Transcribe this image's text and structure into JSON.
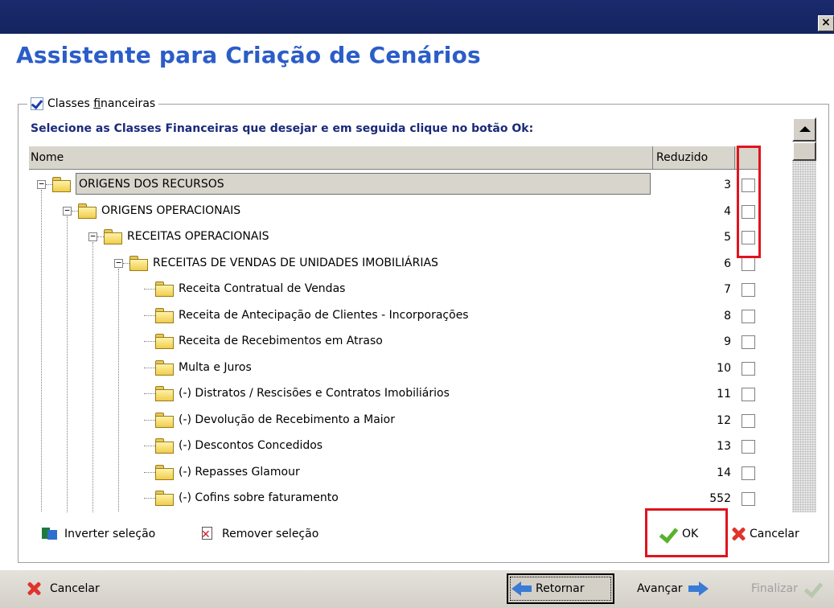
{
  "window": {
    "close_glyph": "×"
  },
  "wizard": {
    "title": "Assistente para Criação de Cenários"
  },
  "group": {
    "label": "Classes financeiras",
    "checked": true,
    "instruction": "Selecione as Classes Financeiras que desejar e em seguida clique no botão Ok:"
  },
  "table": {
    "columns": {
      "name": "Nome",
      "reduced": "Reduzido"
    },
    "rows": [
      {
        "name": "ORIGENS DOS RECURSOS",
        "reduced": "3",
        "level": 0,
        "expandable": true,
        "selected": true
      },
      {
        "name": "ORIGENS OPERACIONAIS",
        "reduced": "4",
        "level": 1,
        "expandable": true
      },
      {
        "name": "RECEITAS OPERACIONAIS",
        "reduced": "5",
        "level": 2,
        "expandable": true
      },
      {
        "name": "RECEITAS DE VENDAS DE UNIDADES IMOBILIÁRIAS",
        "reduced": "6",
        "level": 3,
        "expandable": true
      },
      {
        "name": "Receita Contratual de Vendas",
        "reduced": "7",
        "level": 4,
        "expandable": false
      },
      {
        "name": "Receita de Antecipação de Clientes - Incorporações",
        "reduced": "8",
        "level": 4,
        "expandable": false
      },
      {
        "name": "Receita de Recebimentos em Atraso",
        "reduced": "9",
        "level": 4,
        "expandable": false
      },
      {
        "name": "Multa e Juros",
        "reduced": "10",
        "level": 4,
        "expandable": false
      },
      {
        "name": "(-) Distratos / Rescisões e Contratos Imobiliários",
        "reduced": "11",
        "level": 4,
        "expandable": false
      },
      {
        "name": "(-) Devolução de Recebimento a Maior",
        "reduced": "12",
        "level": 4,
        "expandable": false
      },
      {
        "name": "(-) Descontos Concedidos",
        "reduced": "13",
        "level": 4,
        "expandable": false
      },
      {
        "name": "(-) Repasses Glamour",
        "reduced": "14",
        "level": 4,
        "expandable": false
      },
      {
        "name": "(-) Cofins sobre faturamento",
        "reduced": "552",
        "level": 4,
        "expandable": false
      }
    ]
  },
  "actions": {
    "invert_selection": "Inverter seleção",
    "remove_selection": "Remover seleção",
    "ok": "OK",
    "cancel": "Cancelar"
  },
  "footer": {
    "cancel": "Cancelar",
    "back": "Retornar",
    "next": "Avançar",
    "finish": "Finalizar"
  },
  "colors": {
    "title_bar": "#14245f",
    "wizard_title": "#2b5dc8",
    "highlight_box": "#e0141e",
    "instruction": "#1a2a7a"
  }
}
